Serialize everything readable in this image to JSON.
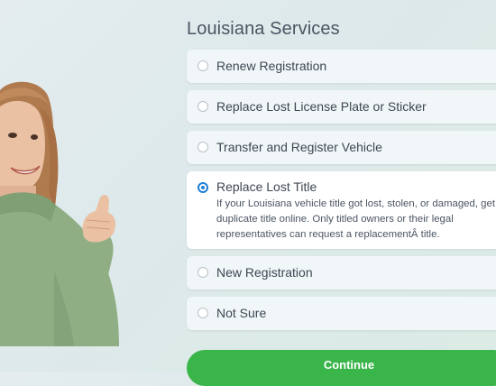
{
  "page": {
    "title": "Louisiana Services"
  },
  "options": [
    {
      "label": "Renew Registration",
      "selected": false
    },
    {
      "label": "Replace Lost License Plate or Sticker",
      "selected": false
    },
    {
      "label": "Transfer and Register Vehicle",
      "selected": false
    },
    {
      "label": "Replace Lost Title",
      "selected": true,
      "description": "If your Louisiana vehicle title got lost, stolen, or damaged, get a duplicate title online. Only titled owners or their legal representatives can request a replacementÂ title."
    },
    {
      "label": "New Registration",
      "selected": false
    },
    {
      "label": "Not Sure",
      "selected": false
    }
  ],
  "actions": {
    "continue_label": "Continue"
  },
  "colors": {
    "accent_blue": "#1e7fd6",
    "continue_green": "#39b54a",
    "sweater_green": "#8fae84"
  }
}
